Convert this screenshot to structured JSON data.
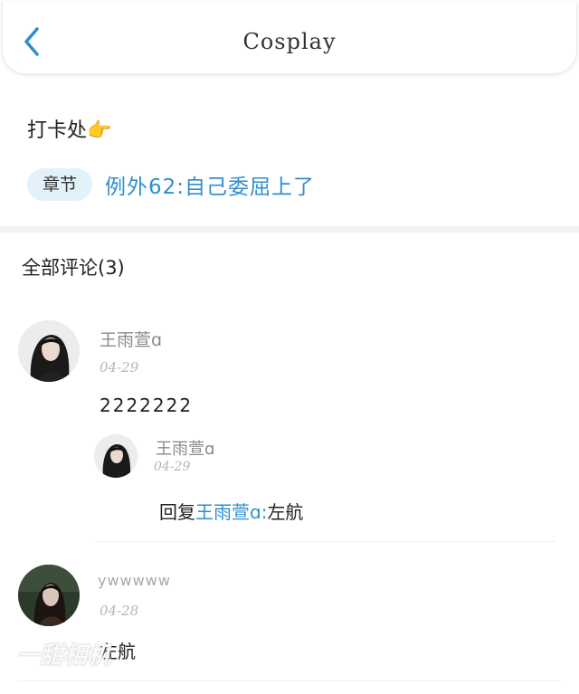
{
  "nav": {
    "title": "Cosplay",
    "back_icon": "chevron-left-icon",
    "accent": "#2e8fcf"
  },
  "post": {
    "text": "打卡处👉",
    "chapter_tag": "章节",
    "chapter_link": "例外62:自己委屈上了"
  },
  "comments": {
    "title": "全部评论(3)",
    "items": [
      {
        "username": "王雨萱ɑ",
        "date": "04-29",
        "content": "2222222",
        "reply": {
          "username": "王雨萱ɑ",
          "date": "04-29",
          "reply_prefix": "回复",
          "reply_to": "王雨萱ɑ:",
          "reply_text": "左航"
        }
      },
      {
        "username": "ywwwww",
        "date": "04-28",
        "content": "左航"
      }
    ]
  },
  "watermark": "一甜相机"
}
